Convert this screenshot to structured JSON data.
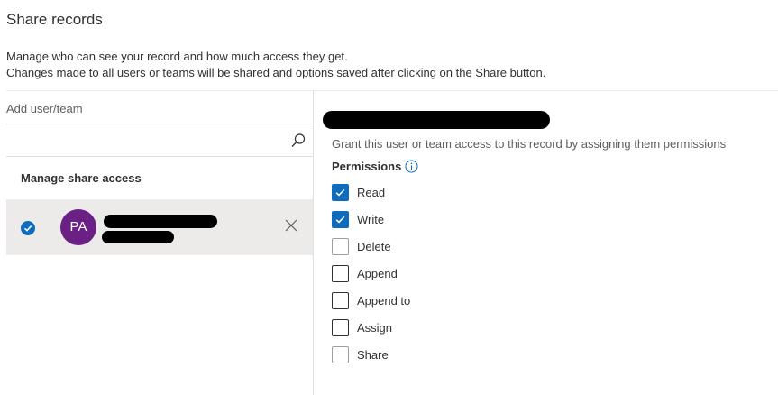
{
  "dialog": {
    "title": "Share records",
    "description_line1": "Manage who can see your record and how much access they get.",
    "description_line2": "Changes made to all users or teams will be shared and options saved after clicking on the Share button."
  },
  "left_panel": {
    "add_label": "Add user/team",
    "search_value": "",
    "search_icon": "search-icon",
    "manage_label": "Manage share access",
    "selected_user": {
      "initials": "PA",
      "avatar_color": "#6b2183",
      "selected": true,
      "remove_icon": "close-icon"
    }
  },
  "right_panel": {
    "grant_text": "Grant this user or team access to this record by assigning them permissions",
    "permissions_heading": "Permissions",
    "info_icon": "info-icon",
    "permissions": [
      {
        "label": "Read",
        "checked": true
      },
      {
        "label": "Write",
        "checked": true
      },
      {
        "label": "Delete",
        "checked": false
      },
      {
        "label": "Append",
        "checked": false
      },
      {
        "label": "Append to",
        "checked": false
      },
      {
        "label": "Assign",
        "checked": false
      },
      {
        "label": "Share",
        "checked": false
      }
    ]
  },
  "colors": {
    "accent": "#0f6cbd",
    "selected_row_bg": "#edebe9",
    "divider": "#e1dfdd"
  }
}
